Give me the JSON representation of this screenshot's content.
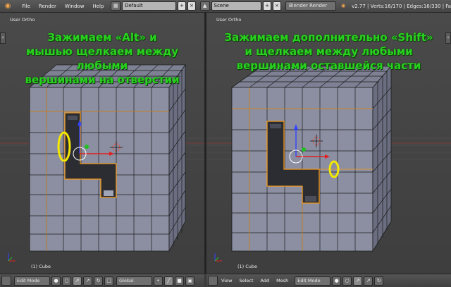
{
  "topbar": {
    "menus": [
      "File",
      "Render",
      "Window",
      "Help"
    ],
    "screen_layout": "Default",
    "scene": "Scene",
    "render_engine": "Blender Render",
    "stats": "v2.77 | Verts:16/170 | Edges:16/330 | Fa"
  },
  "left_viewport": {
    "view_label": "User Ortho",
    "caption_lines": [
      "Зажимаем «Alt» и",
      "мышью щелкаем между любыми",
      "вершинами на отверстии"
    ],
    "object_label": "(1) Cube"
  },
  "right_viewport": {
    "view_label": "User Ortho",
    "caption_lines": [
      "Зажимаем дополнительно «Shift»",
      "и щелкаем между любыми",
      "вершинами оставшейся части"
    ],
    "object_label": "(1) Cube"
  },
  "bottom_left": {
    "mode": "Edit Mode",
    "orientation": "Global"
  },
  "bottom_right": {
    "menus": [
      "View",
      "Select",
      "Add",
      "Mesh"
    ],
    "mode": "Edit Mode"
  },
  "colors": {
    "caption": "#29d21f",
    "highlight_ring": "#f3e800",
    "selected_edge": "#f39a1d",
    "cube_face": "#8a8ea0",
    "hole": "#2b2d33"
  },
  "icons": [
    "blender-logo-icon",
    "view-type-icon",
    "close-icon",
    "viewport-shading-icon",
    "pivot-icon",
    "manipulator-icon"
  ]
}
